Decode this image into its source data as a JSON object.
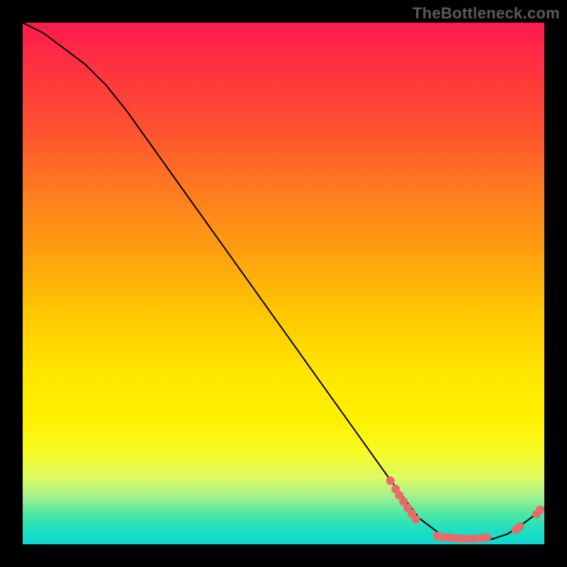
{
  "watermark": "TheBottleneck.com",
  "chart_data": {
    "type": "line",
    "title": "",
    "xlabel": "",
    "ylabel": "",
    "xlim": [
      0,
      100
    ],
    "ylim": [
      0,
      100
    ],
    "grid": false,
    "series": [
      {
        "name": "curve",
        "x": [
          0,
          4,
          8,
          12,
          16,
          20,
          25,
          30,
          35,
          40,
          45,
          50,
          55,
          60,
          65,
          70,
          73,
          76,
          80,
          83,
          86,
          90,
          93,
          96,
          100
        ],
        "y": [
          100,
          98,
          95,
          92,
          88,
          83,
          76,
          69,
          62,
          55,
          48,
          41,
          34,
          27,
          20,
          13,
          9,
          5,
          2,
          1,
          1,
          1,
          2,
          4,
          7
        ],
        "color": "#000000"
      }
    ],
    "points": [
      {
        "name": "cluster-left",
        "shape": "circle",
        "color": "#e96a6a",
        "coords": [
          {
            "x": 70.5,
            "y": 12.2
          },
          {
            "x": 71.5,
            "y": 10.6
          },
          {
            "x": 72.2,
            "y": 9.4
          },
          {
            "x": 73.0,
            "y": 8.2
          },
          {
            "x": 73.8,
            "y": 7.0
          },
          {
            "x": 74.6,
            "y": 5.9
          },
          {
            "x": 75.4,
            "y": 4.8
          }
        ]
      },
      {
        "name": "cluster-bottom",
        "shape": "circle",
        "color": "#e96a6a",
        "coords": [
          {
            "x": 79.5,
            "y": 1.6
          },
          {
            "x": 80.5,
            "y": 1.4
          },
          {
            "x": 81.6,
            "y": 1.3
          },
          {
            "x": 82.8,
            "y": 1.2
          },
          {
            "x": 84.0,
            "y": 1.1
          },
          {
            "x": 85.2,
            "y": 1.1
          },
          {
            "x": 86.5,
            "y": 1.1
          },
          {
            "x": 87.8,
            "y": 1.2
          },
          {
            "x": 89.0,
            "y": 1.3
          }
        ]
      },
      {
        "name": "cluster-right",
        "shape": "circle",
        "color": "#e96a6a",
        "coords": [
          {
            "x": 94.5,
            "y": 2.8
          },
          {
            "x": 95.3,
            "y": 3.4
          },
          {
            "x": 98.5,
            "y": 5.8
          },
          {
            "x": 99.2,
            "y": 6.6
          }
        ]
      }
    ]
  }
}
